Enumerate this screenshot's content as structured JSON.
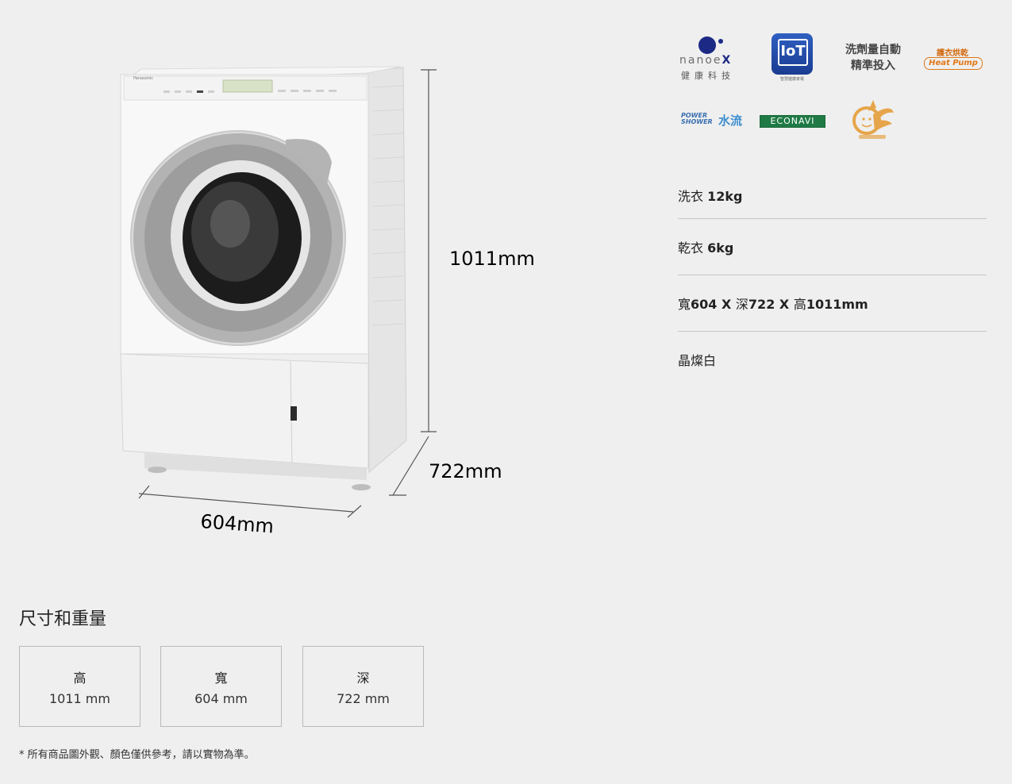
{
  "product_figure": {
    "brand": "Panasonic",
    "height_label": "1011mm",
    "depth_label": "722mm",
    "width_label": "604mm"
  },
  "feature_logos": {
    "nanoex": {
      "word_a": "nanoe",
      "word_b": "X",
      "sub": "健康科技",
      "icon": "nanoe-x-logo"
    },
    "iot": {
      "text": "IoT",
      "sub": "智慧健康家電",
      "icon": "iot-logo"
    },
    "detergent": {
      "line1": "洗劑量自動",
      "line2": "精準投入",
      "icon": "auto-detergent-logo"
    },
    "heat_pump": {
      "top": "護衣烘乾",
      "bottom": "Heat Pump",
      "icon": "heat-pump-logo"
    },
    "power_shower": {
      "line1": "POWER",
      "line2": "SHOWER",
      "suffix": "水流",
      "icon": "power-shower-logo"
    },
    "econavi": {
      "text": "ECONAVI",
      "icon": "econavi-logo"
    },
    "energy_mark": {
      "icon": "energy-saving-mark-icon"
    }
  },
  "specs": {
    "wash": {
      "label": "洗衣 ",
      "value": "12kg"
    },
    "dry": {
      "label": "乾衣 ",
      "value": "6kg"
    },
    "dimensions": {
      "w_label": "寬",
      "w": "604",
      "x1": " X ",
      "d_label": "深",
      "d": "722",
      "x2": " X ",
      "h_label": "高",
      "h": "1011mm"
    },
    "color": "晶燦白"
  },
  "dimension_section": {
    "title": "尺寸和重量",
    "cards": [
      {
        "label": "高",
        "value": "1011 mm"
      },
      {
        "label": "寬",
        "value": "604 mm"
      },
      {
        "label": "深",
        "value": "722 mm"
      }
    ]
  },
  "disclaimer": "* 所有商品圖外觀、顏色僅供參考，請以實物為準。",
  "colors": {
    "background": "#efefef",
    "nanoe_blue": "#1c2a86",
    "iot_blue": "#2f5fc2",
    "heat_pump_orange": "#e07818",
    "econavi_green": "#1f7a45",
    "divider": "#c7c7c7"
  }
}
